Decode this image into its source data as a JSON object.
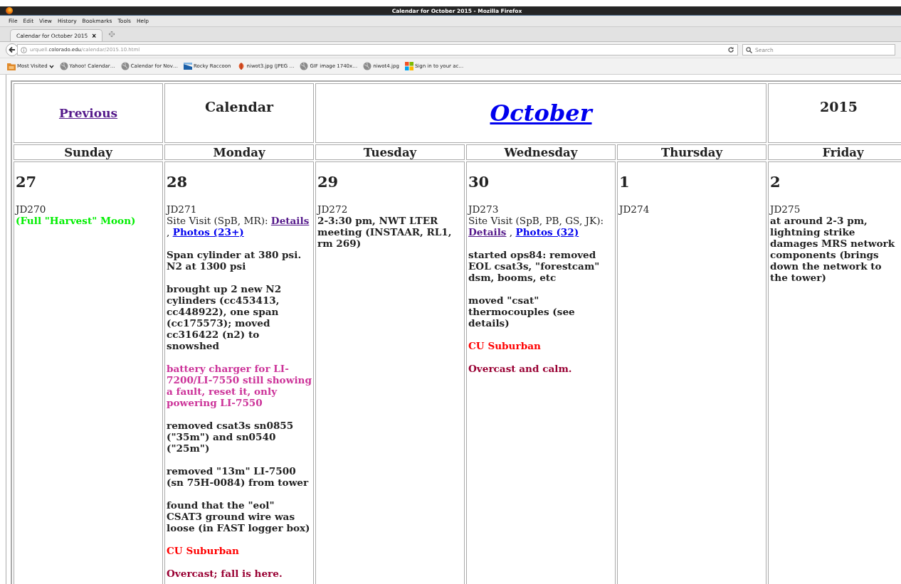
{
  "window": {
    "title": "Calendar for October 2015 - Mozilla Firefox"
  },
  "menu": [
    "File",
    "Edit",
    "View",
    "History",
    "Bookmarks",
    "Tools",
    "Help"
  ],
  "tab": {
    "title": "Calendar for October 2015",
    "close": "×"
  },
  "address": {
    "host_prefix": "urquell.",
    "host": "colorado.edu",
    "path": "/calendar/2015.10.html"
  },
  "search": {
    "placeholder": "Search"
  },
  "bookmarks": [
    {
      "label": "Most Visited",
      "menu": true
    },
    {
      "label": "Yahoo! Calendar…",
      "menu": false
    },
    {
      "label": "Calendar for Nov…",
      "menu": false
    },
    {
      "label": "Rocky Raccoon",
      "menu": false
    },
    {
      "label": "niwot3.jpg (JPEG …",
      "menu": false
    },
    {
      "label": "GIF image 1740x…",
      "menu": false
    },
    {
      "label": "niwot4.jpg",
      "menu": false
    },
    {
      "label": "Sign in to your ac…",
      "menu": false
    }
  ],
  "calendar": {
    "previous": {
      "label": "Previous",
      "visited": true
    },
    "title": "Calendar",
    "month": {
      "label": "October",
      "visited": false
    },
    "year": "2015",
    "weekdays": [
      "Sunday",
      "Monday",
      "Tuesday",
      "Wednesday",
      "Thursday",
      "Friday"
    ],
    "days": [
      {
        "date": "27",
        "jd": "JD270",
        "entries": [
          {
            "kind": "note",
            "text": "(Full \"Harvest\" Moon)",
            "color": "#00ee00"
          }
        ]
      },
      {
        "date": "28",
        "jd": "JD271",
        "entries": [
          {
            "kind": "visit",
            "text": "Site Visit (SpB, MR):",
            "separator": ",",
            "links": [
              {
                "label": "Details",
                "visited": true
              },
              {
                "label": "Photos (23+)",
                "visited": false
              }
            ]
          },
          {
            "kind": "note",
            "text": "Span cylinder at 380 psi. N2 at 1300 psi",
            "color": "#222222"
          },
          {
            "kind": "note",
            "text": "brought up 2 new N2 cylinders (cc453413, cc448922), one span (cc175573); moved cc316422 (n2) to snowshed",
            "color": "#222222"
          },
          {
            "kind": "note",
            "text": "battery charger for LI-7200/LI-7550 still showing a fault, reset it, only powering LI-7550",
            "color": "#cc3399"
          },
          {
            "kind": "note",
            "text": "removed csat3s sn0855 (\"35m\") and sn0540 (\"25m\")",
            "color": "#222222"
          },
          {
            "kind": "note",
            "text": "removed \"13m\" LI-7500 (sn 75H-0084) from tower",
            "color": "#222222"
          },
          {
            "kind": "note",
            "text": "found that the \"eol\" CSAT3 ground wire was loose (in FAST logger box)",
            "color": "#222222"
          },
          {
            "kind": "note",
            "text": "CU Suburban",
            "color": "#ff0000"
          },
          {
            "kind": "note",
            "text": "Overcast; fall is here.",
            "color": "#990033"
          }
        ]
      },
      {
        "date": "29",
        "jd": "JD272",
        "entries": [
          {
            "kind": "note",
            "text": "2-3:30 pm, NWT LTER meeting (INSTAAR, RL1, rm 269)",
            "color": "#222222"
          }
        ]
      },
      {
        "date": "30",
        "jd": "JD273",
        "entries": [
          {
            "kind": "visit",
            "text": "Site Visit (SpB, PB, GS, JK):",
            "separator": ",",
            "links": [
              {
                "label": "Details",
                "visited": true
              },
              {
                "label": "Photos (32)",
                "visited": false
              }
            ]
          },
          {
            "kind": "note",
            "text": "started ops84: removed EOL csat3s, \"forestcam\" dsm, booms, etc",
            "color": "#222222"
          },
          {
            "kind": "note",
            "text": "moved \"csat\" thermocouples (see details)",
            "color": "#222222"
          },
          {
            "kind": "note",
            "text": "CU Suburban",
            "color": "#ff0000"
          },
          {
            "kind": "note",
            "text": "Overcast and calm.",
            "color": "#990033"
          }
        ]
      },
      {
        "date": "1",
        "jd": "JD274"
      },
      {
        "date": "2",
        "jd": "JD275",
        "entries": [
          {
            "kind": "note",
            "text": "at around 2-3 pm, lightning strike damages MRS network components (brings down the network to the tower)",
            "color": "#222222"
          }
        ]
      }
    ]
  }
}
